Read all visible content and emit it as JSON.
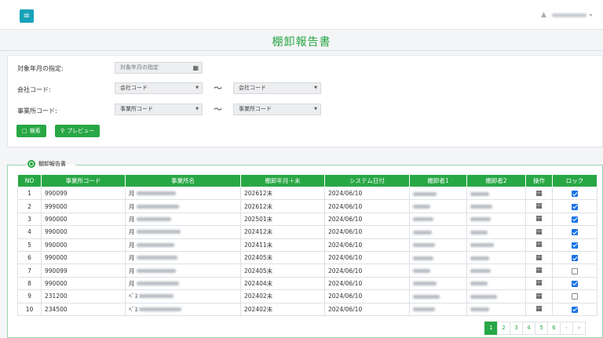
{
  "header": {
    "menu_icon": "hamburger-icon",
    "user_icon": "user-icon",
    "user_caret": "▾"
  },
  "page": {
    "title": "棚卸報告書"
  },
  "search": {
    "target_month_label": "対象年月の指定:",
    "target_month_placeholder": "対象年月の指定",
    "company_code_label": "会社コード:",
    "company_code_from": "会社コード",
    "company_code_to": "会社コード",
    "office_code_label": "事業所コード:",
    "office_code_from": "事業所コード",
    "office_code_to": "事業所コード",
    "range_sep": "〜",
    "search_button": "検索",
    "preview_button": "プレビュー"
  },
  "results": {
    "legend": "棚卸報告書",
    "columns": [
      "NO",
      "事業所コード",
      "事業所名",
      "棚卸年月＋末",
      "システム日付",
      "棚卸者1",
      "棚卸者2",
      "操作",
      "ロック"
    ],
    "rows": [
      {
        "no": "1",
        "office_code": "990099",
        "name_prefix": "月",
        "period": "202612末",
        "sys_date": "2024/06/10",
        "locked": true
      },
      {
        "no": "2",
        "office_code": "999000",
        "name_prefix": "月",
        "period": "202612末",
        "sys_date": "2024/06/10",
        "locked": true
      },
      {
        "no": "3",
        "office_code": "990000",
        "name_prefix": "月",
        "period": "202501末",
        "sys_date": "2024/06/10",
        "locked": true
      },
      {
        "no": "4",
        "office_code": "990000",
        "name_prefix": "月",
        "period": "202412末",
        "sys_date": "2024/06/10",
        "locked": true
      },
      {
        "no": "5",
        "office_code": "990000",
        "name_prefix": "月",
        "period": "202411末",
        "sys_date": "2024/06/10",
        "locked": true
      },
      {
        "no": "6",
        "office_code": "990000",
        "name_prefix": "月",
        "period": "202405末",
        "sys_date": "2024/06/10",
        "locked": true
      },
      {
        "no": "7",
        "office_code": "990099",
        "name_prefix": "月",
        "period": "202405末",
        "sys_date": "2024/06/10",
        "locked": false
      },
      {
        "no": "8",
        "office_code": "990000",
        "name_prefix": "月",
        "period": "202404末",
        "sys_date": "2024/06/10",
        "locked": true
      },
      {
        "no": "9",
        "office_code": "231200",
        "name_prefix": "ﾍﾞｽ",
        "period": "202402末",
        "sys_date": "2024/06/10",
        "locked": false
      },
      {
        "no": "10",
        "office_code": "234500",
        "name_prefix": "ﾍﾞｽ",
        "period": "202402末",
        "sys_date": "2024/06/10",
        "locked": true
      }
    ]
  },
  "pagination": {
    "pages": [
      "1",
      "2",
      "3",
      "4",
      "5",
      "6"
    ],
    "active": "1",
    "next": "›",
    "last": "»"
  },
  "colors": {
    "accent": "#28a745",
    "header_button": "#17a2b8",
    "checkbox": "#1a73e8"
  }
}
